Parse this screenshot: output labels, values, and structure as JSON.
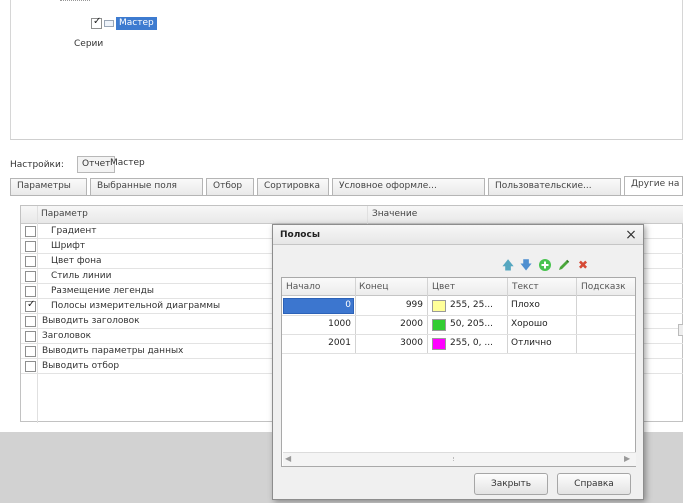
{
  "tree": {
    "selected_item": "Мастер",
    "item_series": "Серии"
  },
  "settings": {
    "label": "Настройки:",
    "tabs": [
      "Отчет",
      "Мастер"
    ]
  },
  "tabs": [
    "Параметры",
    "Выбранные поля",
    "Отбор",
    "Сортировка",
    "Условное оформле...",
    "Пользовательские...",
    "Другие на"
  ],
  "grid": {
    "col_param": "Параметр",
    "col_value": "Значение",
    "rows": [
      {
        "label": "Градиент",
        "checked": false,
        "indent": true
      },
      {
        "label": "Шрифт",
        "checked": false,
        "indent": true
      },
      {
        "label": "Цвет фона",
        "checked": false,
        "indent": true
      },
      {
        "label": "Стиль линии",
        "checked": false,
        "indent": true
      },
      {
        "label": "Размещение легенды",
        "checked": false,
        "indent": true
      },
      {
        "label": "Полосы измерительной диаграммы",
        "checked": true,
        "indent": true
      },
      {
        "label": "Выводить заголовок",
        "checked": false,
        "indent": false
      },
      {
        "label": "Заголовок",
        "checked": false,
        "indent": false
      },
      {
        "label": "Выводить параметры данных",
        "checked": false,
        "indent": false
      },
      {
        "label": "Выводить отбор",
        "checked": false,
        "indent": false
      }
    ]
  },
  "dialog": {
    "title": "Полосы",
    "close_symbol": "×",
    "toolbar_icons": [
      "move-up-icon",
      "move-down-icon",
      "add-icon",
      "edit-icon",
      "delete-icon"
    ],
    "columns": [
      "Начало",
      "Конец",
      "Цвет",
      "Текст",
      "Подсказк"
    ],
    "rows": [
      {
        "start": "0",
        "end": "999",
        "color_text": "255, 25...",
        "color": "#ffff99",
        "text": "Плохо"
      },
      {
        "start": "1000",
        "end": "2000",
        "color_text": "50, 205...",
        "color": "#32cd32",
        "text": "Хорошо"
      },
      {
        "start": "2001",
        "end": "3000",
        "color_text": "255, 0, ...",
        "color": "#ff00ff",
        "text": "Отлично"
      }
    ],
    "buttons": {
      "close": "Закрыть",
      "help": "Справка"
    }
  }
}
